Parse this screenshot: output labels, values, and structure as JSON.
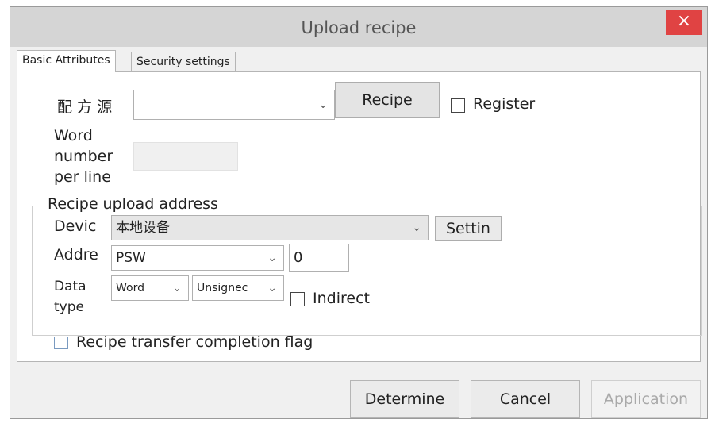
{
  "window": {
    "title": "Upload recipe",
    "close_glyph": "×"
  },
  "tabs": [
    {
      "label": "Basic Attributes",
      "active": true
    },
    {
      "label": "Security settings",
      "active": false
    }
  ],
  "recipe_source": {
    "label": "配 方 源",
    "value": "",
    "button": "Recipe",
    "register_label": "Register"
  },
  "word_number": {
    "label_lines": [
      "Word",
      "number",
      "per line"
    ],
    "value": ""
  },
  "upload_address": {
    "title": "Recipe upload address",
    "device_label": "Devic",
    "device_value": "本地设备",
    "settings_button": "Settin",
    "address_label": "Addre",
    "address_type": "PSW",
    "address_value": "0",
    "data_type_label_lines": [
      "Data",
      "type"
    ],
    "data_type_size": "Word",
    "data_type_sign": "Unsignec",
    "indirect_label": "Indirect"
  },
  "completion_flag": {
    "label": "Recipe transfer completion flag"
  },
  "footer": {
    "determine": "Determine",
    "cancel": "Cancel",
    "application": "Application"
  },
  "icons": {
    "dropdown": "chevron-down-icon",
    "close": "close-icon"
  }
}
